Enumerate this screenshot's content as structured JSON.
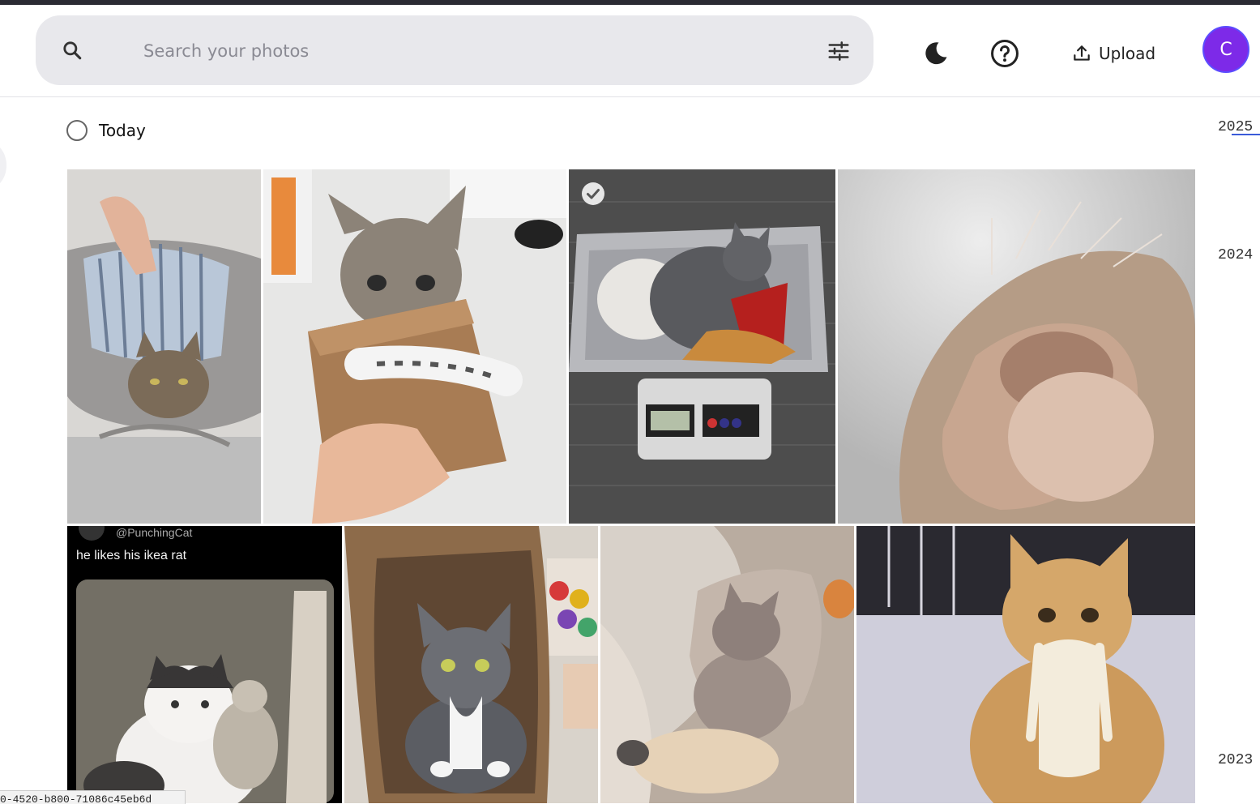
{
  "search": {
    "placeholder": "Search your photos"
  },
  "header": {
    "upload_label": "Upload",
    "avatar_initial": "C"
  },
  "group": {
    "date_label": "Today"
  },
  "photos": [
    {
      "subject": "cat in bag",
      "selected": false
    },
    {
      "subject": "kitten in box",
      "selected": false
    },
    {
      "subject": "kitten on scale",
      "selected": true
    },
    {
      "subject": "cat nose closeup",
      "selected": false
    },
    {
      "subject": "tweet cat with rat",
      "selected": false,
      "tweet_user": "@PunchingCat",
      "tweet_text": "he likes his ikea rat"
    },
    {
      "subject": "cat in paper bag",
      "selected": false
    },
    {
      "subject": "sphynx cat",
      "selected": false
    },
    {
      "subject": "orange cat mustache",
      "selected": false
    }
  ],
  "timeline": {
    "years": [
      "2025",
      "2024",
      "2023"
    ]
  },
  "status_bar": {
    "text": "0-4520-b800-71086c45eb6d"
  },
  "colors": {
    "accent": "#7d2ae8",
    "search_bg": "#e8e8ec"
  }
}
